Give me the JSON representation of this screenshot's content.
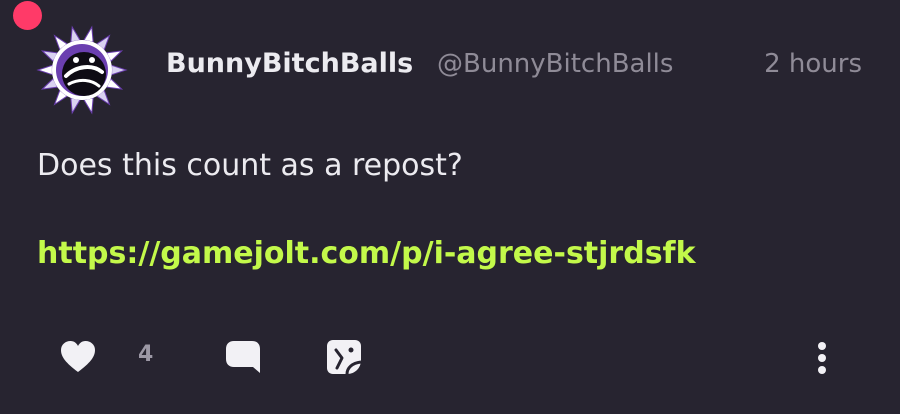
{
  "post": {
    "author": {
      "display_name": "BunnyBitchBalls",
      "username": "@BunnyBitchBalls",
      "avatar_icon": "spiky-sun-avatar-icon"
    },
    "timestamp": "2 hours",
    "text": "Does this count as a repost?",
    "link": "https://gamejolt.com/p/i-agree-stjrdsfk"
  },
  "actions": {
    "like_count": "4",
    "like_icon": "heart-icon",
    "comment_icon": "comment-bubble-icon",
    "share_icon": "share-sticker-icon",
    "more_icon": "more-vertical-icon"
  },
  "colors": {
    "background": "#272430",
    "link": "#c3f94a",
    "notification_dot": "#ff3a68",
    "muted_text": "#8f8b97"
  }
}
